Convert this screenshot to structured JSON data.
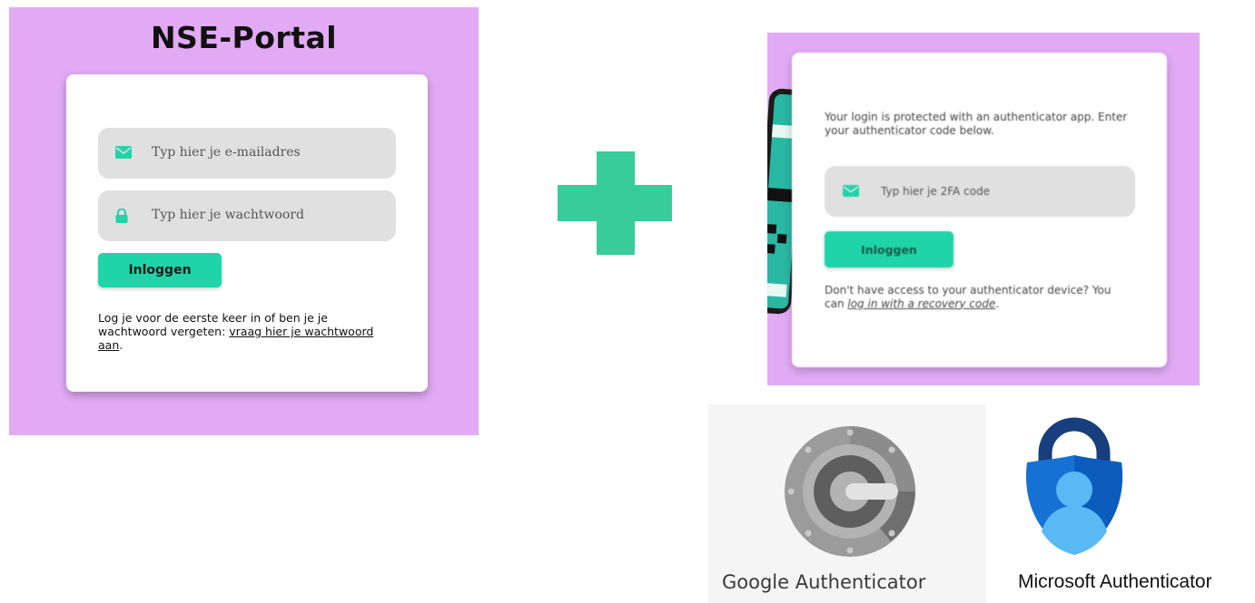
{
  "login_panel": {
    "title": "NSE-Portal",
    "email_placeholder": "Typ hier je e-mailadres",
    "password_placeholder": "Typ hier je wachtwoord",
    "login_button": "Inloggen",
    "help_text_prefix": "Log je voor de eerste keer in of ben je je wachtwoord vergeten: ",
    "help_link": "vraag hier je wachtwoord aan",
    "help_text_suffix": ".",
    "accent_color": "#1fd4a9",
    "background_color": "#e2aaf5"
  },
  "plus_sign": {
    "color": "#37cc99"
  },
  "twofa_panel": {
    "info_text": "Your login is protected with an authenticator app. Enter your authenticator code below.",
    "code_placeholder": "Typ hier je 2FA code",
    "login_button": "Inloggen",
    "recovery_prefix": "Don't have access to your authenticator device? You can ",
    "recovery_link": "log in with a recovery code",
    "recovery_suffix": "."
  },
  "authenticator_apps": [
    {
      "name": "Google Authenticator",
      "icon": "google-authenticator-icon"
    },
    {
      "name": "Microsoft Authenticator",
      "icon": "microsoft-authenticator-icon"
    }
  ]
}
